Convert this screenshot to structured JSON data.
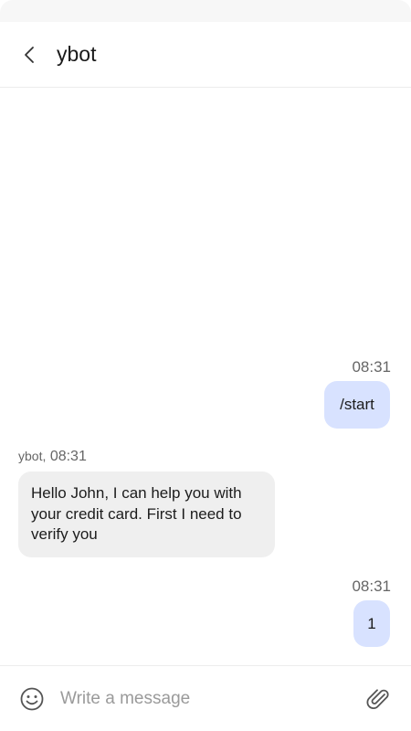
{
  "header": {
    "title": "ybot",
    "back_icon": "chevron-left-icon"
  },
  "messages": [
    {
      "direction": "out",
      "time": "08:31",
      "text": "/start"
    },
    {
      "direction": "in",
      "sender": "ybot,",
      "time": "08:31",
      "text": "Hello John, I can help you with your credit card. First I need to verify you"
    },
    {
      "direction": "out",
      "time": "08:31",
      "text": "1"
    }
  ],
  "composer": {
    "placeholder": "Write a message",
    "value": "",
    "emoji_icon": "emoji-icon",
    "attach_icon": "paperclip-icon"
  },
  "colors": {
    "outgoing_bubble": "#d8e2ff",
    "incoming_bubble": "#efefef",
    "background": "#ffffff"
  }
}
